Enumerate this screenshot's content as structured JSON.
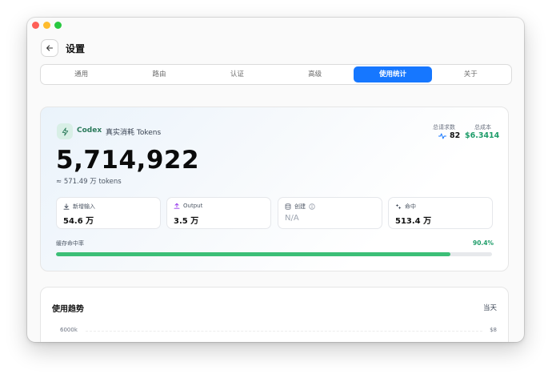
{
  "window": {
    "title": "设置",
    "traffic_lights": [
      "#fe5f57",
      "#febc2e",
      "#28c840"
    ]
  },
  "nav": {
    "back_icon": "arrow-left-icon",
    "tabs": [
      {
        "label": "通用",
        "active": false
      },
      {
        "label": "路由",
        "active": false
      },
      {
        "label": "认证",
        "active": false
      },
      {
        "label": "高级",
        "active": false
      },
      {
        "label": "使用统计",
        "active": true
      },
      {
        "label": "关于",
        "active": false
      }
    ]
  },
  "summary": {
    "brand": "Codex",
    "separator": "·",
    "subtitle": "真实消耗 Tokens",
    "total_requests_label": "总请求数",
    "total_requests_value": "82",
    "total_cost_label": "总成本",
    "total_cost_value": "$6.3414",
    "total_tokens": "5,714,922",
    "total_tokens_approx": "≈ 571.49 万 tokens",
    "metrics": [
      {
        "label": "新增输入",
        "value": "54.6 万",
        "icon": "download-icon",
        "muted": false
      },
      {
        "label": "Output",
        "value": "3.5 万",
        "icon": "upload-icon",
        "muted": false
      },
      {
        "label": "创建",
        "value": "N/A",
        "icon": "database-icon",
        "info_icon": "info-icon",
        "muted": true
      },
      {
        "label": "命中",
        "value": "513.4 万",
        "icon": "sparkle-icon",
        "muted": false
      }
    ],
    "cache_rate_label": "缓存命中率",
    "cache_rate_value": "90.4%",
    "cache_rate_fraction": 0.904,
    "accent_color": "#1f9d6a",
    "bar_color": "#3cbf77"
  },
  "trend": {
    "title": "使用趋势",
    "range": "当天",
    "y_left_top": "6000k",
    "y_right_top": "$8"
  }
}
